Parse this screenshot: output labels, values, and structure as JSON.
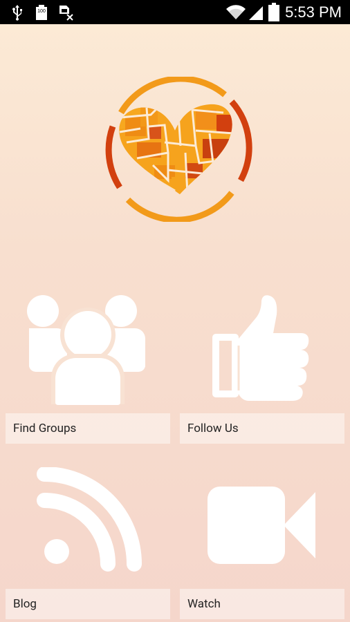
{
  "status_bar": {
    "time": "5:53 PM",
    "battery_small_label": "100",
    "icons": [
      "usb-icon",
      "battery-full-icon",
      "no-sim-icon",
      "wifi-icon",
      "signal-icon",
      "battery-icon"
    ]
  },
  "logo": {
    "name": "mosaic-heart-logo"
  },
  "tiles": [
    {
      "label": "Find Groups",
      "icon": "groups-icon"
    },
    {
      "label": "Follow Us",
      "icon": "thumbs-up-icon"
    },
    {
      "label": "Blog",
      "icon": "rss-icon"
    },
    {
      "label": "Watch",
      "icon": "video-camera-icon"
    }
  ],
  "colors": {
    "orange_light": "#f5a01c",
    "orange_dark": "#d24a12",
    "background_top": "#fcebd6",
    "background_bottom": "#f5d6cb"
  }
}
